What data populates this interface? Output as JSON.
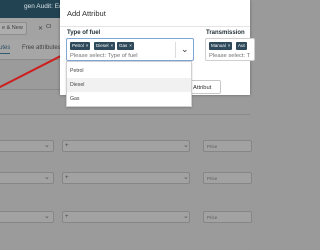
{
  "background": {
    "title": "gen Audit: Editing a p",
    "toolbar": {
      "save_new": "e & New",
      "close": "Cl"
    },
    "tabs": [
      {
        "label": "utes",
        "active": true
      },
      {
        "label": "Free attributes",
        "active": false
      }
    ],
    "rows": [
      {
        "plus": "+",
        "price_placeholder": "Price"
      },
      {
        "plus": "+",
        "price_placeholder": "Price"
      },
      {
        "plus": "+",
        "price_placeholder": "Price"
      }
    ],
    "arrow_color": "#cc1f1f"
  },
  "modal": {
    "title": "Add Attribut",
    "fuel": {
      "label": "Type of fuel",
      "chips": [
        "Petrol",
        "Diesel",
        "Gas"
      ],
      "placeholder": "Please select: Type of fuel",
      "options": [
        "Petrol",
        "Diesel",
        "Gas"
      ],
      "hovered_option": "Diesel"
    },
    "transmission": {
      "label": "Transmission",
      "chips": [
        "Manual",
        "Aut"
      ],
      "placeholder": "Please select: T"
    },
    "add_button": "Attribut"
  },
  "colors": {
    "header_bg": "#224352",
    "chip_bg": "#2e4a5a",
    "focus_border": "#7fa6d4",
    "overlay": "#9a9a9a"
  }
}
